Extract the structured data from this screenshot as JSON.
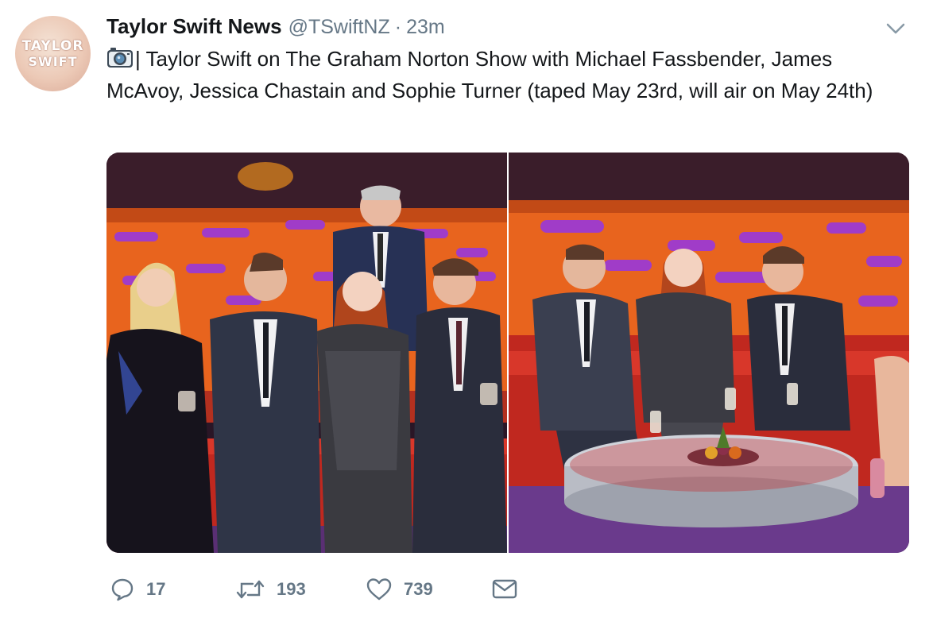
{
  "tweet": {
    "avatar_text_line1": "TAYLOR",
    "avatar_text_line2": "SWIFT",
    "author_name": "Taylor Swift News",
    "handle": "@TSwiftNZ",
    "separator": "·",
    "time": "23m",
    "text": "| Taylor Swift on The Graham Norton Show with Michael Fassbender, James McAvoy, Jessica Chastain and Sophie Turner (taped May 23rd, will air on May 24th)",
    "icons": {
      "camera": "camera-icon",
      "caret": "chevron-down-icon"
    }
  },
  "actions": {
    "replies": "17",
    "retweets": "193",
    "likes": "739"
  },
  "colors": {
    "text": "#14171a",
    "secondary": "#657786",
    "studio_orange": "#e8641e",
    "sofa_red": "#c8281f",
    "purple": "#a03cc8"
  }
}
